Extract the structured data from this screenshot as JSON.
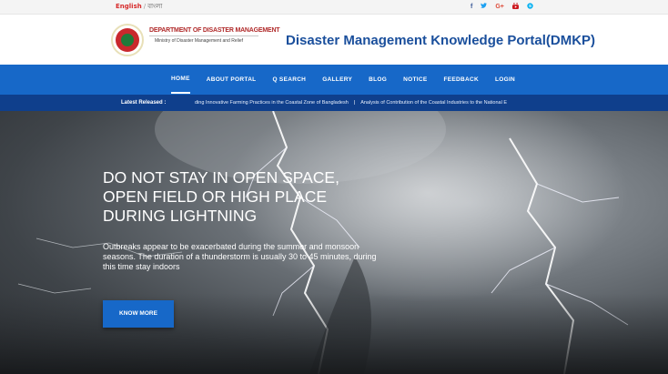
{
  "topbar": {
    "lang_english": "English",
    "lang_separator": "/",
    "lang_bangla": "বাংলা",
    "social": [
      {
        "icon": "facebook-icon",
        "glyph": "f",
        "color": "#3b5998"
      },
      {
        "icon": "twitter-icon",
        "glyph": "🐦",
        "color": "#1da1f2"
      },
      {
        "icon": "google-plus-icon",
        "glyph": "G+",
        "color": "#dd4b39"
      },
      {
        "icon": "youtube-icon",
        "glyph": "▶",
        "color": "#cc181e"
      },
      {
        "icon": "skype-icon",
        "glyph": "S",
        "color": "#00aff0"
      }
    ]
  },
  "header": {
    "dept_name": "DEPARTMENT OF DISASTER MANAGEMENT",
    "ministry": "Ministry of Disaster Management and Relief",
    "portal_title": "Disaster Management Knowledge Portal(DMKP)"
  },
  "nav": {
    "items": [
      {
        "label": "HOME",
        "active": true
      },
      {
        "label": "ABOUT PORTAL",
        "active": false
      },
      {
        "label": "Q SEARCH",
        "active": false
      },
      {
        "label": "GALLERY",
        "active": false
      },
      {
        "label": "BLOG",
        "active": false
      },
      {
        "label": "NOTICE",
        "active": false
      },
      {
        "label": "FEEDBACK",
        "active": false
      },
      {
        "label": "LOGIN",
        "active": false
      }
    ]
  },
  "ticker": {
    "label": "Latest Released :",
    "item1": "ding Innovative Farming Practices in the Coastal Zone of Bangladesh",
    "divider": "|",
    "item2": "Analysis of Contribution of the Coastal Industries to the National E"
  },
  "hero": {
    "heading_line1": "DO NOT STAY IN OPEN SPACE,",
    "heading_line2": "OPEN FIELD OR HIGH PLACE",
    "heading_line3": "DURING LIGHTNING",
    "text": "Outbreaks appear to be exacerbated during the summer and monsoon seasons. The duration of a thunderstorm is usually 30 to 45 minutes, during this time stay indoors",
    "button_label": "KNOW MORE"
  },
  "colors": {
    "nav_blue": "#1768c8",
    "ticker_blue": "#0f3f8c",
    "title_blue": "#1a4f9c",
    "dept_red": "#b02a2a"
  }
}
